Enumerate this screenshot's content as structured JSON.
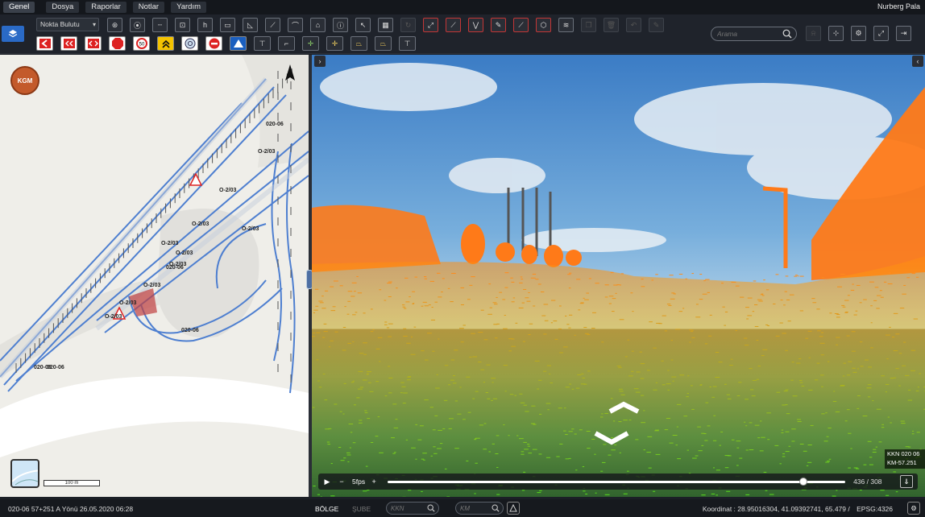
{
  "menu": {
    "tabs": [
      "Genel",
      "Dosya",
      "Raporlar",
      "Notlar",
      "Yardım"
    ],
    "active": "Genel",
    "user": "Nurberg Pala"
  },
  "toolbar": {
    "layer_select": "Nokta Bulutu",
    "search_placeholder": "Arama"
  },
  "map": {
    "logo_text": "KGM",
    "scale_label": "100 m",
    "road_labels": [
      "020-06",
      "O-2/03",
      "O-2/03",
      "O-2/03",
      "O-2/03",
      "O-2/03",
      "020-06",
      "O-2/03",
      "O-2/03",
      "020-06",
      "O-2/03",
      "020-06",
      "O-2/03",
      "020-06",
      "O-2/03"
    ]
  },
  "viewer": {
    "kkn_line1": "KKN 020 06",
    "kkn_line2": "KM-57.251",
    "fps": "5fps",
    "frame_counter": "436 / 308",
    "progress": 0.9
  },
  "status": {
    "route_info": "020-06  57+251  A Yönü  26.05.2020 06:28",
    "bolge": "BÖLGE",
    "sube": "ŞUBE",
    "kkn_placeholder": "KKN",
    "km_placeholder": "KM",
    "coordinate": "Koordinat : 28.95016304, 41.09392741, 65.479 /",
    "epsg": "EPSG:4326"
  }
}
